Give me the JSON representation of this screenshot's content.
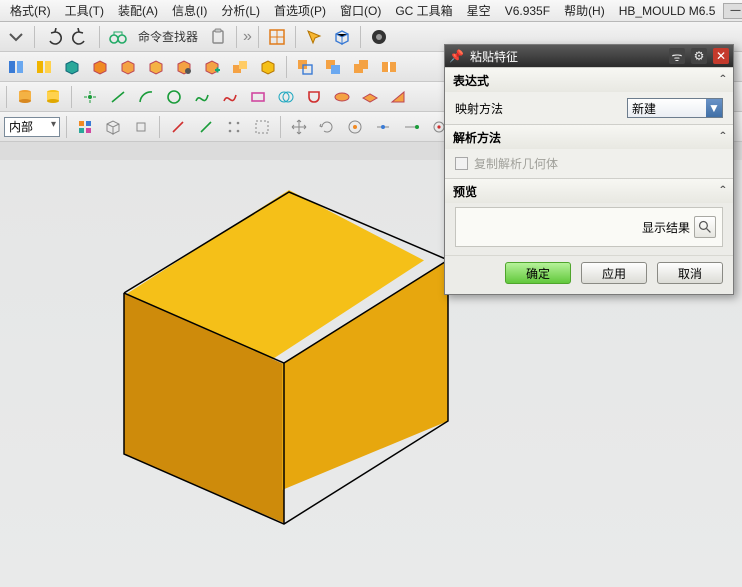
{
  "menu": {
    "items": [
      "格式(R)",
      "工具(T)",
      "装配(A)",
      "信息(I)",
      "分析(L)",
      "首选项(P)",
      "窗口(O)",
      "GC 工具箱",
      "星空",
      "V6.935F",
      "帮助(H)",
      "HB_MOULD M6.5"
    ]
  },
  "toolbar1": {
    "finder_label": "命令查找器"
  },
  "toolbar4": {
    "dropdown_value": "内部"
  },
  "dialog": {
    "title": "粘贴特征",
    "sections": {
      "expression": {
        "label": "表达式"
      },
      "mapping": {
        "label": "映射方法",
        "select_value": "新建"
      },
      "resolve": {
        "label": "解析方法",
        "checkbox_label": "复制解析几何体"
      },
      "preview": {
        "label": "预览",
        "result_label": "显示结果"
      }
    },
    "buttons": {
      "ok": "确定",
      "apply": "应用",
      "cancel": "取消"
    }
  },
  "icons": {
    "undo": "undo",
    "redo": "redo",
    "search": "search",
    "gear": "gear",
    "close": "×",
    "target": "◎"
  }
}
